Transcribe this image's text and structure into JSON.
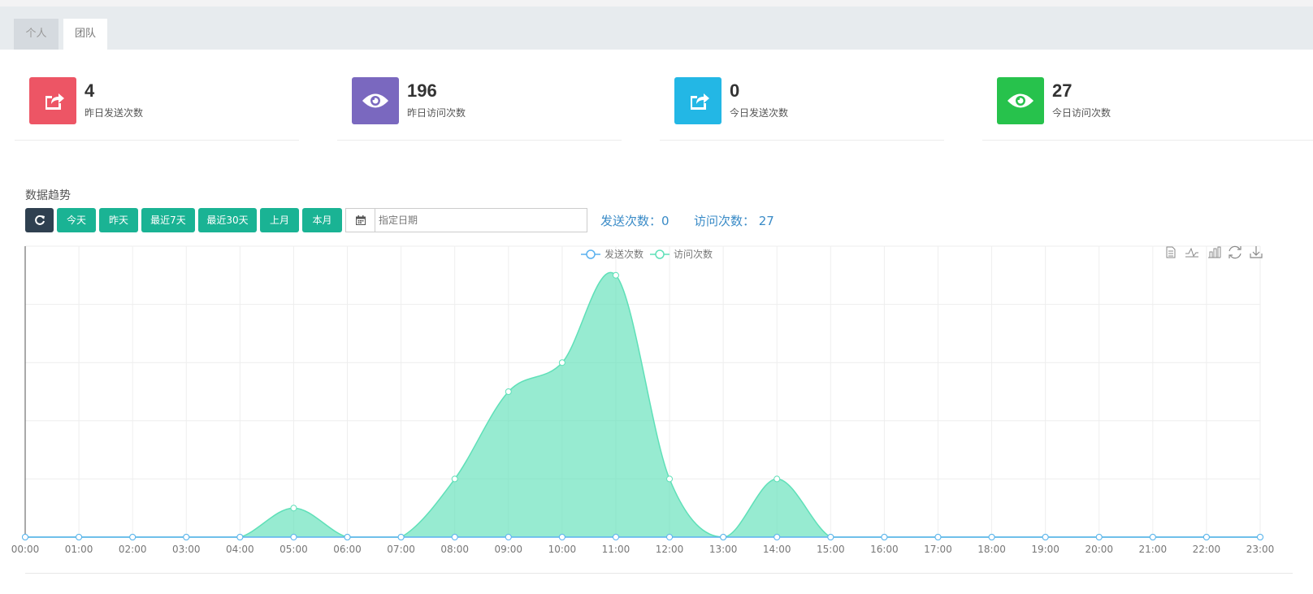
{
  "tabs": [
    {
      "label": "个人",
      "active": false
    },
    {
      "label": "团队",
      "active": true
    }
  ],
  "stats": [
    {
      "value": "4",
      "label": "昨日发送次数",
      "color": "#ed5565",
      "icon": "share-icon"
    },
    {
      "value": "196",
      "label": "昨日访问次数",
      "color": "#7a68bf",
      "icon": "eye-icon"
    },
    {
      "value": "0",
      "label": "今日发送次数",
      "color": "#23b7e5",
      "icon": "share-icon"
    },
    {
      "value": "27",
      "label": "今日访问次数",
      "color": "#27c24c",
      "icon": "eye-icon"
    }
  ],
  "trend": {
    "title": "数据趋势",
    "buttons": {
      "refresh_icon": "refresh-icon",
      "today": "今天",
      "yesterday": "昨天",
      "last7": "最近7天",
      "last30": "最近30天",
      "last_month": "上月",
      "this_month": "本月"
    },
    "date_placeholder": "指定日期",
    "send_summary": "发送次数：0",
    "visit_summary": "访问次数： 27",
    "toolbox_icons": [
      "data-view-icon",
      "line-chart-icon",
      "bar-chart-icon",
      "restore-icon",
      "save-image-icon"
    ]
  },
  "chart_data": {
    "type": "area",
    "x": [
      "00:00",
      "01:00",
      "02:00",
      "03:00",
      "04:00",
      "05:00",
      "06:00",
      "07:00",
      "08:00",
      "09:00",
      "10:00",
      "11:00",
      "12:00",
      "13:00",
      "14:00",
      "15:00",
      "16:00",
      "17:00",
      "18:00",
      "19:00",
      "20:00",
      "21:00",
      "22:00",
      "23:00"
    ],
    "series": [
      {
        "name": "发送次数",
        "color": "#5ab1ef",
        "values": [
          0,
          0,
          0,
          0,
          0,
          0,
          0,
          0,
          0,
          0,
          0,
          0,
          0,
          0,
          0,
          0,
          0,
          0,
          0,
          0,
          0,
          0,
          0,
          0
        ]
      },
      {
        "name": "访问次数",
        "color": "#5fe0b8",
        "values": [
          0,
          0,
          0,
          0,
          0,
          1,
          0,
          0,
          2,
          5,
          6,
          9,
          2,
          0,
          2,
          0,
          0,
          0,
          0,
          0,
          0,
          0,
          0,
          0
        ]
      }
    ],
    "ylim": [
      0,
      10
    ],
    "smooth": true,
    "grid": true,
    "legend": "top-center",
    "xlabel": "",
    "ylabel": ""
  }
}
